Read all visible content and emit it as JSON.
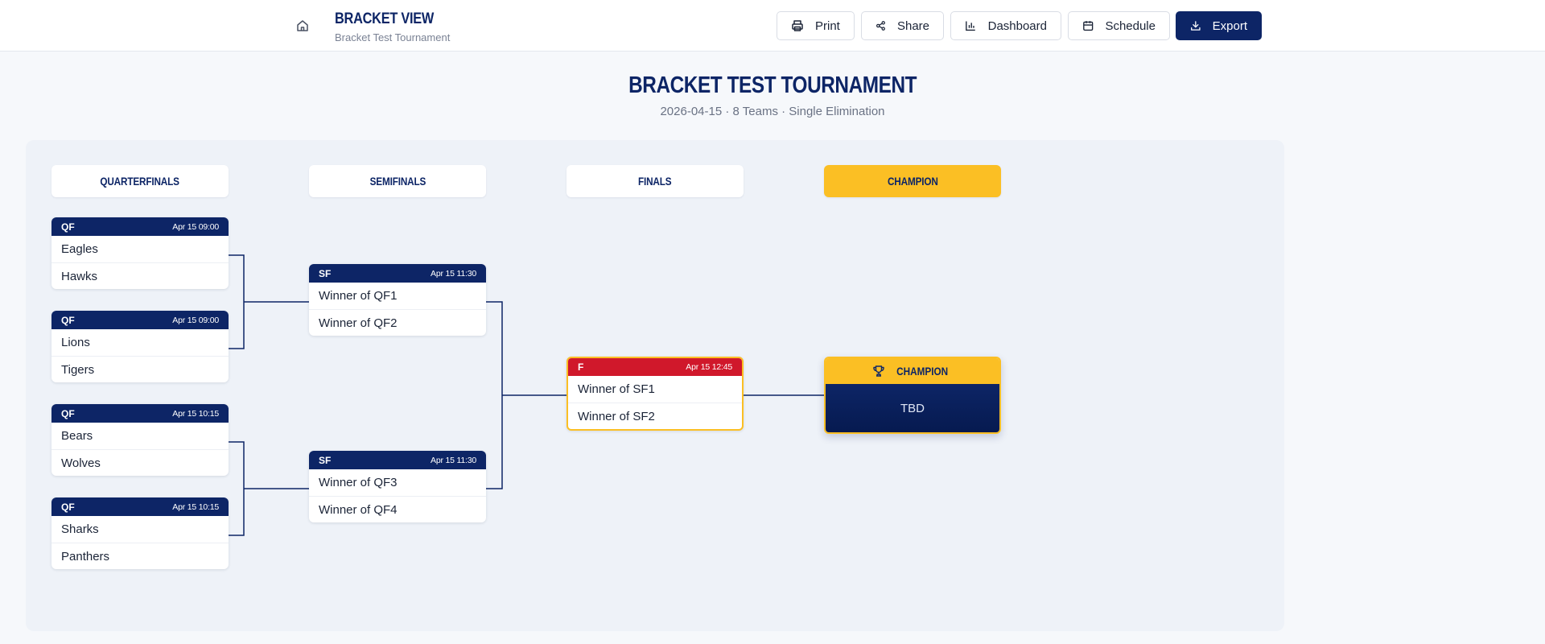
{
  "header": {
    "title": "BRACKET VIEW",
    "subtitle": "Bracket Test Tournament",
    "buttons": {
      "print": "Print",
      "share": "Share",
      "dashboard": "Dashboard",
      "schedule": "Schedule",
      "export": "Export"
    }
  },
  "tournament": {
    "title": "BRACKET TEST TOURNAMENT",
    "meta": "2026-04-15 · 8 Teams · Single Elimination"
  },
  "rounds": {
    "qf": "QUARTERFINALS",
    "sf": "SEMIFINALS",
    "final": "FINALS",
    "champion": "CHAMPION"
  },
  "matches": {
    "qf1": {
      "code": "QF",
      "time": "Apr 15 09:00",
      "team1": "Eagles",
      "team2": "Hawks"
    },
    "qf2": {
      "code": "QF",
      "time": "Apr 15 09:00",
      "team1": "Lions",
      "team2": "Tigers"
    },
    "qf3": {
      "code": "QF",
      "time": "Apr 15 10:15",
      "team1": "Bears",
      "team2": "Wolves"
    },
    "qf4": {
      "code": "QF",
      "time": "Apr 15 10:15",
      "team1": "Sharks",
      "team2": "Panthers"
    },
    "sf1": {
      "code": "SF",
      "time": "Apr 15 11:30",
      "team1": "Winner of QF1",
      "team2": "Winner of QF2"
    },
    "sf2": {
      "code": "SF",
      "time": "Apr 15 11:30",
      "team1": "Winner of QF3",
      "team2": "Winner of QF4"
    },
    "final": {
      "code": "F",
      "time": "Apr 15 12:45",
      "team1": "Winner of SF1",
      "team2": "Winner of SF2"
    }
  },
  "champion_card": {
    "label": "CHAMPION",
    "value": "TBD"
  },
  "colors": {
    "navy": "#0d2566",
    "gold": "#fbbf24",
    "final_red": "#d0182b"
  },
  "icons": {
    "home": "home-icon",
    "print": "printer-icon",
    "share": "share-icon",
    "dashboard": "bar-chart-icon",
    "schedule": "calendar-icon",
    "export": "download-icon",
    "champion": "trophy-icon"
  }
}
